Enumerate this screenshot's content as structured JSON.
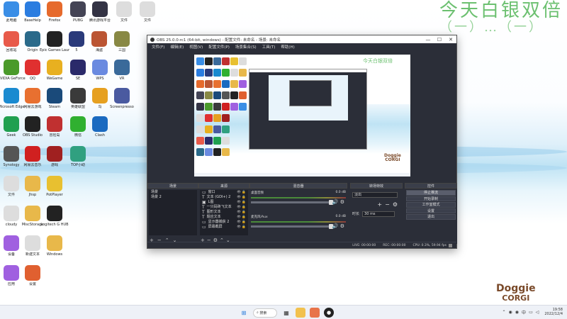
{
  "desktop": {
    "deco_title": "今天白银双倍",
    "deco_subtitle": "（一）…（一）",
    "doggie_line1": "Doggie",
    "doggie_line2": "CORGI",
    "icons": [
      {
        "label": "此电脑",
        "icon": "computer-icon",
        "color": "#3a8ee6"
      },
      {
        "label": "BaseHelp",
        "icon": "compass-icon",
        "color": "#2b7de0"
      },
      {
        "label": "Firefox",
        "icon": "firefox-icon",
        "color": "#e66a2c"
      },
      {
        "label": "PUBG",
        "icon": "game-icon",
        "color": "#445"
      },
      {
        "label": "腾讯游戏平台",
        "icon": "game-icon",
        "color": "#334"
      },
      {
        "label": "文件",
        "icon": "file-icon",
        "color": "#ddd"
      },
      {
        "label": "文件",
        "icon": "file-icon",
        "color": "#ddd"
      },
      {
        "label": "回收站",
        "icon": "recycle-bin-icon",
        "color": "#e85a4a"
      },
      {
        "label": "Origin",
        "icon": "origin-icon",
        "color": "#2a6a8a"
      },
      {
        "label": "Epic Games Launcher",
        "icon": "epic-icon",
        "color": "#222"
      },
      {
        "label": "5",
        "icon": "app-icon",
        "color": "#2a3a7a"
      },
      {
        "label": "海盗",
        "icon": "game-icon",
        "color": "#b53"
      },
      {
        "label": "三国",
        "icon": "game-icon",
        "color": "#884"
      },
      {
        "label": "NVIDIA GeForce",
        "icon": "nvidia-icon",
        "color": "#4a9a2a"
      },
      {
        "label": "QQ",
        "icon": "qq-icon",
        "color": "#e03030"
      },
      {
        "label": "WeGame",
        "icon": "wegame-icon",
        "color": "#e8b020"
      },
      {
        "label": "SE",
        "icon": "app-icon",
        "color": "#2a2a6a"
      },
      {
        "label": "WPS",
        "icon": "butterfly-icon",
        "color": "#6a8ae0"
      },
      {
        "label": "VR",
        "icon": "vr-icon",
        "color": "#3a6a9a"
      },
      {
        "label": "Microsoft Edge",
        "icon": "edge-icon",
        "color": "#1a8ad0"
      },
      {
        "label": "网易云游戏",
        "icon": "game-icon",
        "color": "#e87030"
      },
      {
        "label": "Steam",
        "icon": "steam-icon",
        "color": "#1a4a7a"
      },
      {
        "label": "英雄联盟",
        "icon": "game-icon",
        "color": "#3a3a3a"
      },
      {
        "label": "鸟",
        "icon": "bird-icon",
        "color": "#e6a020"
      },
      {
        "label": "Screenpresso",
        "icon": "app-icon",
        "color": "#4a5aa0"
      },
      {
        "label": "Geek",
        "icon": "app-icon",
        "color": "#20a050"
      },
      {
        "label": "OBS Studio",
        "icon": "obs-icon",
        "color": "#222"
      },
      {
        "label": "冒险岛",
        "icon": "game-icon",
        "color": "#c03030"
      },
      {
        "label": "微信",
        "icon": "wechat-icon",
        "color": "#30b030"
      },
      {
        "label": "Clash",
        "icon": "app-icon",
        "color": "#1a6ac0"
      },
      {
        "label": "Synology",
        "icon": "app-icon",
        "color": "#555"
      },
      {
        "label": "网易云音乐",
        "icon": "music-icon",
        "color": "#d02020"
      },
      {
        "label": "游戏",
        "icon": "game-icon",
        "color": "#a02020"
      },
      {
        "label": "TOP小助",
        "icon": "app-icon",
        "color": "#30a080"
      },
      {
        "label": "文件",
        "icon": "file-icon",
        "color": "#ddd"
      },
      {
        "label": "Jhsp",
        "icon": "folder-icon",
        "color": "#e8b84a"
      },
      {
        "label": "PotPlayer",
        "icon": "play-icon",
        "color": "#e8c030"
      },
      {
        "label": "cloudy",
        "icon": "file-icon",
        "color": "#ddd"
      },
      {
        "label": "MiscStorage",
        "icon": "folder-icon",
        "color": "#e8b84a"
      },
      {
        "label": "Logitech G HUB",
        "icon": "logitech-icon",
        "color": "#222"
      },
      {
        "label": "设备",
        "icon": "app-icon",
        "color": "#a060e0"
      },
      {
        "label": "新建文本",
        "icon": "file-icon",
        "color": "#ddd"
      },
      {
        "label": "Windows",
        "icon": "folder-icon",
        "color": "#e8b84a"
      },
      {
        "label": "应用",
        "icon": "app-icon",
        "color": "#a060e0"
      },
      {
        "label": "设置",
        "icon": "app-icon",
        "color": "#e06030"
      }
    ]
  },
  "obs": {
    "title": "OBS 25.0.0-rc1 (64-bit, windows) - 配置文件: 未命名 - 场景: 未命名",
    "menu": [
      "文件(F)",
      "编辑(E)",
      "视图(V)",
      "配置文件(P)",
      "场景集合(S)",
      "工具(T)",
      "帮助(H)"
    ],
    "docks": {
      "scenes": {
        "header": "场景",
        "items": [
          "场景",
          "场景 2"
        ]
      },
      "sources": {
        "header": "来源",
        "items": [
          {
            "name": "窗口",
            "icon": "window-icon"
          },
          {
            "name": "文本 (GDI+) 2",
            "icon": "text-icon"
          },
          {
            "name": "L图",
            "icon": "image-icon"
          },
          {
            "name": "一只码砖飞文本",
            "icon": "text-icon"
          },
          {
            "name": "图形文本",
            "icon": "text-icon"
          },
          {
            "name": "题应文本",
            "icon": "text-icon"
          },
          {
            "name": "显示器捕获 2",
            "icon": "monitor-icon"
          },
          {
            "name": "屏幕截屏",
            "icon": "window-icon"
          }
        ]
      },
      "mixer": {
        "header": "混音器",
        "channels": [
          {
            "name": "桌面音频",
            "db": "0.0 dB"
          },
          {
            "name": "麦克风/Aux",
            "db": "0.0 dB"
          }
        ]
      },
      "transitions": {
        "header": "转场特效",
        "type": "淡出",
        "duration_label": "时长",
        "duration": "30 ms"
      },
      "controls": {
        "header": "控件",
        "buttons": [
          "停止推流",
          "开始录制",
          "工作室模式",
          "设置",
          "退出"
        ]
      }
    },
    "status": {
      "live": "LIVE: 00:00:00",
      "rec": "REC: 00:00:00",
      "cpu": "CPU: 0.3%, 59.94 fps"
    }
  },
  "taskbar": {
    "search": "搜索",
    "time": "19:58",
    "date": "2022/12/4",
    "lang": "中"
  }
}
